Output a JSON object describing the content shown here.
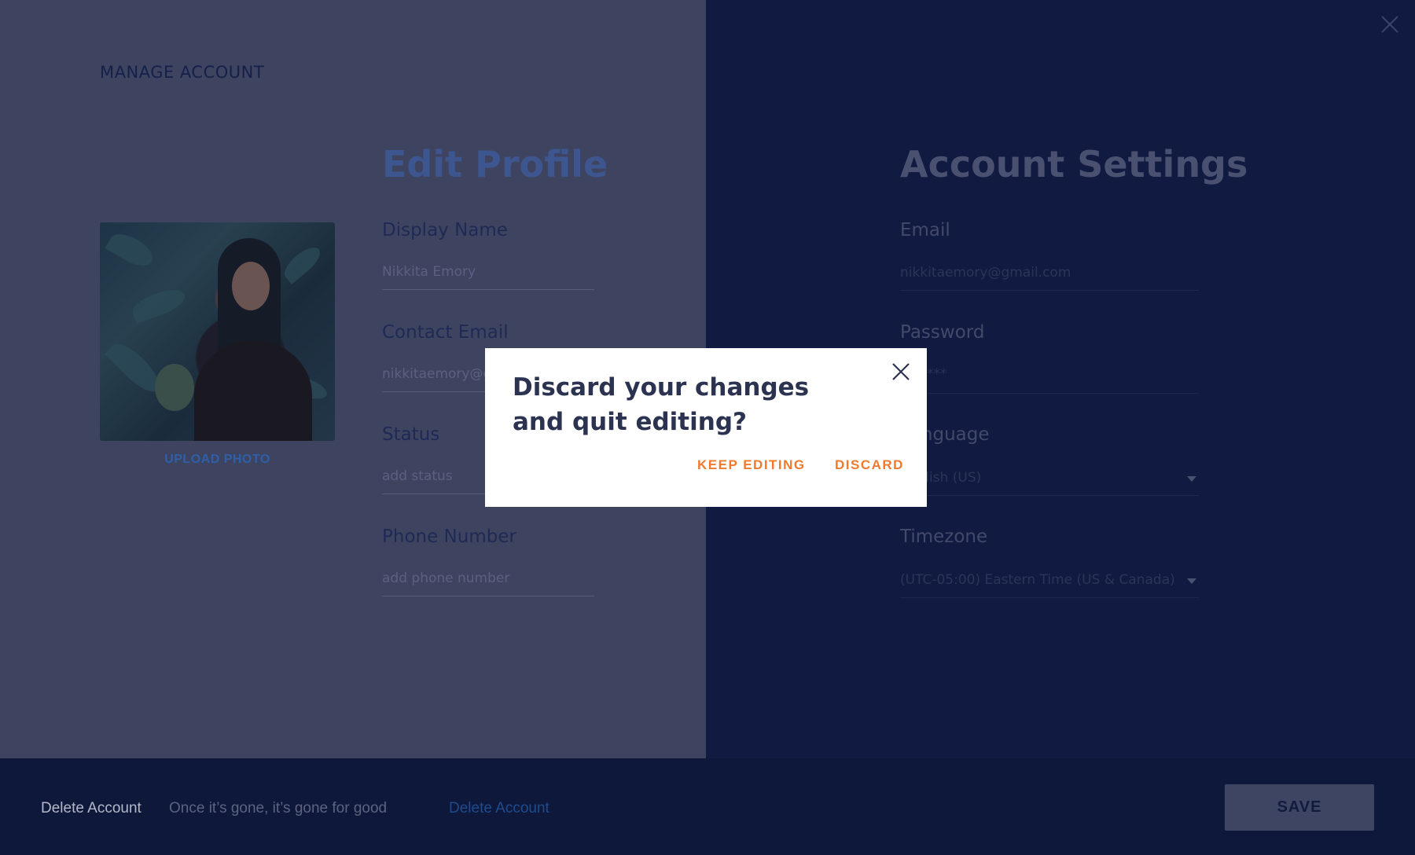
{
  "header": {
    "title": "MANAGE ACCOUNT"
  },
  "profile": {
    "upload_label": "UPLOAD PHOTO",
    "section_title": "Edit Profile",
    "fields": [
      {
        "label": "Display Name",
        "value": "Nikkita Emory"
      },
      {
        "label": "Contact Email",
        "value": "nikkitaemory@g"
      },
      {
        "label": "Status",
        "placeholder": "add status"
      },
      {
        "label": "Phone Number",
        "placeholder": "add phone number"
      }
    ]
  },
  "settings": {
    "section_title": "Account Settings",
    "email": {
      "label": "Email",
      "value": "nikkitaemory@gmail.com"
    },
    "password": {
      "label": "Password",
      "value": "*******"
    },
    "language": {
      "label": "Language",
      "value": "English (US)"
    },
    "timezone": {
      "label": "Timezone",
      "value": "(UTC-05:00) Eastern Time (US & Canada)"
    }
  },
  "footer": {
    "delete_label": "Delete Account",
    "delete_description": "Once it’s gone, it’s gone for good",
    "delete_link": "Delete Account",
    "save_label": "SAVE"
  },
  "modal": {
    "title": "Discard your changes and quit editing?",
    "keep_label": "KEEP EDITING",
    "discard_label": "DISCARD"
  },
  "icons": {
    "top_close": "close-icon",
    "modal_close": "close-icon"
  },
  "colors": {
    "accent": "#ef7a2e",
    "overlay_panel": "#3e4460",
    "background": "#101a3f",
    "link": "#2e5fa8"
  }
}
